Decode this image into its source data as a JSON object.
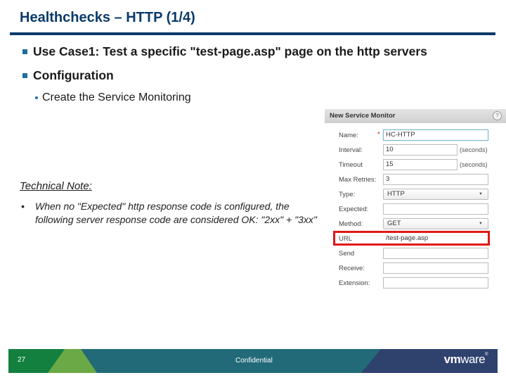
{
  "slide": {
    "title": "Healthchecks – HTTP (1/4)",
    "bullets": [
      {
        "text": "Use Case1: Test a specific \"test-page.asp\" page on the http servers"
      },
      {
        "text": "Configuration"
      }
    ],
    "sub_bullet": "Create the Service Monitoring",
    "technical_note": {
      "title": "Technical Note:",
      "bullet_symbol": "•",
      "text": "When no \"Expected\" http response code is configured, the following server response code are considered OK: \"2xx\" + \"3xx\""
    }
  },
  "dialog": {
    "title": "New Service Monitor",
    "help_icon": "?",
    "fields": {
      "name": {
        "label": "Name:",
        "value": "HC-HTTP",
        "required_marker": "*"
      },
      "interval": {
        "label": "Interval:",
        "value": "10",
        "unit": "(seconds)"
      },
      "timeout": {
        "label": "Timeout",
        "value": "15",
        "unit": "(seconds)"
      },
      "max_retries": {
        "label": "Max Retries:",
        "value": "3"
      },
      "type": {
        "label": "Type:",
        "value": "HTTP",
        "arrow": "▼"
      },
      "expected": {
        "label": "Expected:",
        "value": ""
      },
      "method": {
        "label": "Method:",
        "value": "GET",
        "arrow": "▼"
      },
      "url": {
        "label": "URL",
        "value": "/test-page.asp"
      },
      "send": {
        "label": "Send",
        "value": ""
      },
      "receive": {
        "label": "Receive:",
        "value": ""
      },
      "extension": {
        "label": "Extension:",
        "value": ""
      }
    },
    "highlight_color": "#e01818"
  },
  "footer": {
    "page_number": "27",
    "confidential": "Confidential",
    "logo_vm": "vm",
    "logo_ware": "ware",
    "logo_mark": "®",
    "colors": {
      "green_dark": "#138040",
      "green_light": "#6aa945",
      "teal": "#226a78",
      "navy": "#2f426e"
    }
  }
}
